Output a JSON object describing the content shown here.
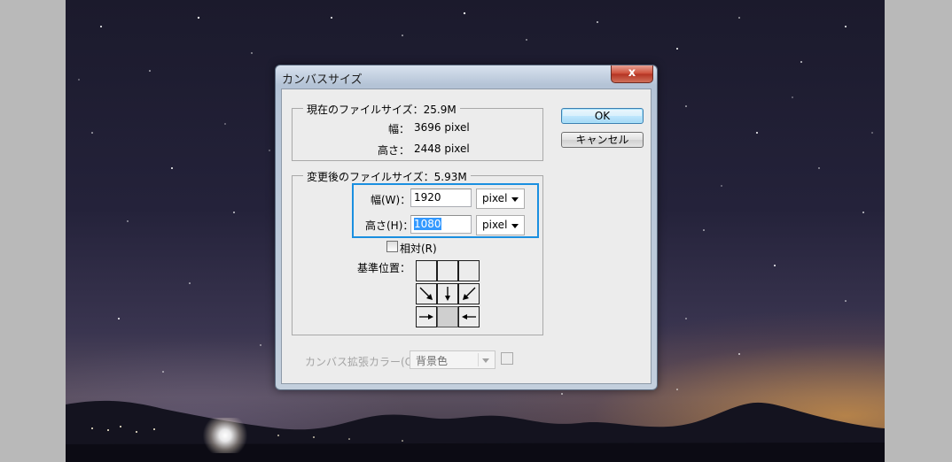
{
  "dialog": {
    "title": "カンバスサイズ",
    "close_label": "x"
  },
  "current_size": {
    "legend": "現在のファイルサイズ：25.9M",
    "width_label": "幅：",
    "width_value": "3696 pixel",
    "height_label": "高さ：",
    "height_value": "2448 pixel"
  },
  "new_size": {
    "legend": "変更後のファイルサイズ：5.93M",
    "width_label": "幅(W)：",
    "width_value": "1920",
    "width_unit": "pixel",
    "height_label": "高さ(H)：",
    "height_value": "1080",
    "height_unit": "pixel",
    "relative_label": "相対(R)",
    "relative_checked": false,
    "anchor_label": "基準位置："
  },
  "buttons": {
    "ok": "OK",
    "cancel": "キャンセル"
  },
  "extension_color": {
    "label": "カンバス拡張カラー(C)：",
    "value": "背景色"
  },
  "colors": {
    "highlight": "#1a8fe0",
    "selection": "#3399ff"
  },
  "icons": [
    "close-icon",
    "arrow-down-right-icon",
    "arrow-down-icon",
    "arrow-down-left-icon",
    "arrow-right-icon",
    "arrow-left-icon",
    "chevron-down-icon"
  ]
}
